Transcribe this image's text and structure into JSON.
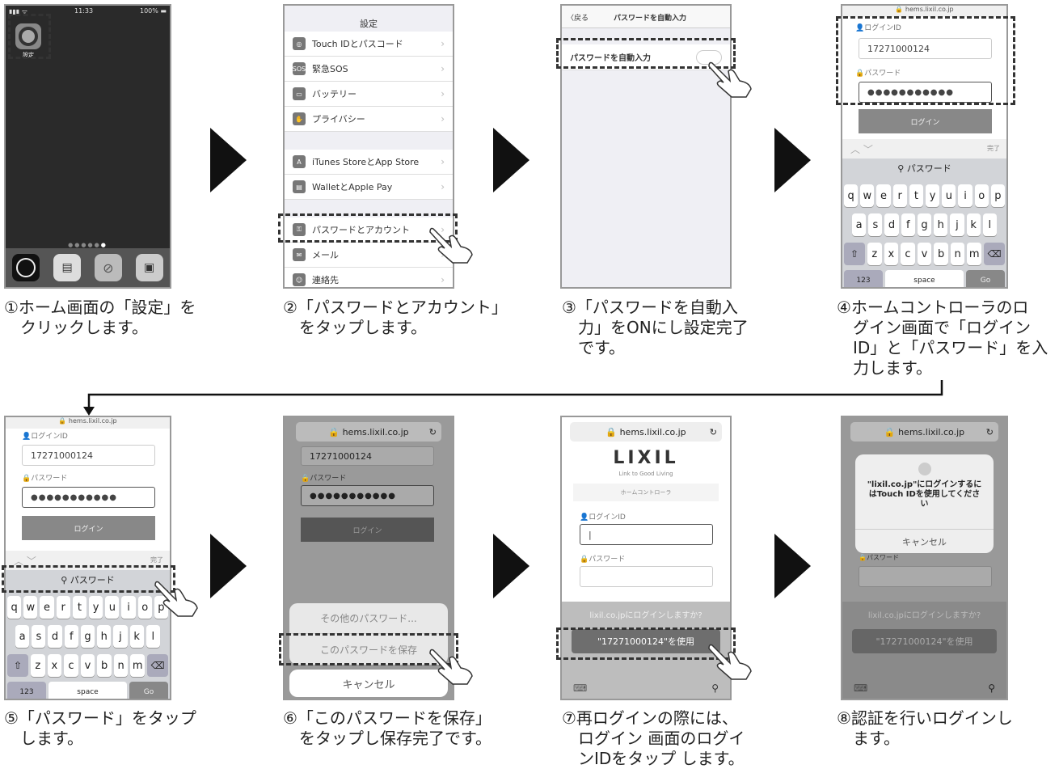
{
  "step1": {
    "time": "11:33",
    "battery": "100%",
    "settings_label": "設定",
    "caption": "①ホーム画面の「設定」を\n　クリックします。"
  },
  "step2": {
    "title": "設定",
    "items": [
      "Touch IDとパスコード",
      "緊急SOS",
      "バッテリー",
      "プライバシー",
      "iTunes StoreとApp Store",
      "WalletとApple Pay",
      "パスワードとアカウント",
      "メール",
      "連絡先"
    ],
    "sos_icon": "SOS",
    "caption": "②「パスワードとアカウント」\n　をタップします。"
  },
  "step3": {
    "back": "戻る",
    "title": "パスワードを自動入力",
    "toggle_label": "パスワードを自動入力",
    "caption": "③「パスワードを自動入\n　力」をONにし設定完了\n　です。"
  },
  "step4": {
    "url": "hems.lixil.co.jp",
    "id_label": "ログインID",
    "id_value": "17271000124",
    "pw_label": "パスワード",
    "pw_value": "●●●●●●●●●●●",
    "login_btn": "ログイン",
    "done": "完了",
    "suggest": "パスワード",
    "row1": "qwertyuiop",
    "row2": "asdfghjkl",
    "row3": "zxcvbnm",
    "num": "123",
    "space": "space",
    "go": "Go",
    "caption": "④ホームコントローラのロ\n　グイン画面で「ログイン\n　ID」と「パスワード」を入\n　力します。"
  },
  "step5": {
    "caption": "⑤「パスワード」をタップ\n　します。"
  },
  "step6": {
    "url": "hems.lixil.co.jp",
    "id_value": "17271000124",
    "pw_label": "パスワード",
    "pw_value": "●●●●●●●●●●●",
    "login_btn": "ログイン",
    "other": "その他のパスワード...",
    "save": "このパスワードを保存",
    "cancel": "キャンセル",
    "caption": "⑥「このパスワードを保存」\n　をタップし保存完了です。"
  },
  "step7": {
    "url": "hems.lixil.co.jp",
    "logo": "LIXIL",
    "tagline": "Link to Good Living",
    "sub": "ホームコントローラ",
    "id_label": "ログインID",
    "pw_label": "パスワード",
    "prompt": "lixil.co.jpにログインしますか?",
    "use": "\"17271000124\"を使用",
    "caption": "⑦再ログインの際には、\n　ログイン 画面のログイ\n　ンIDをタップ します。"
  },
  "step8": {
    "url": "hems.lixil.co.jp",
    "dialog": "\"lixil.co.jp\"にログインするに\nはTouch IDを使用してくださ\nい",
    "cancel": "キャンセル",
    "pw_label": "パスワード",
    "prompt": "lixil.co.jpにログインしますか?",
    "use": "\"17271000124\"を使用",
    "caption": "⑧認証を行いログインし\n　ます。"
  }
}
